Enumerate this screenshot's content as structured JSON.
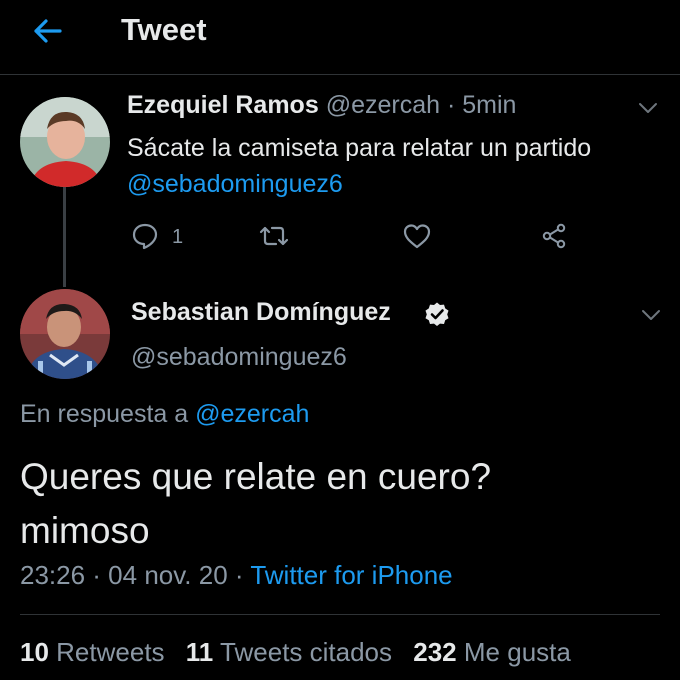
{
  "header": {
    "title": "Tweet"
  },
  "parent_tweet": {
    "name": "Ezequiel Ramos",
    "handle": "@ezercah",
    "time": "· 5min",
    "text": "Sácate la camiseta para relatar un partido",
    "mention": "@sebadominguez6",
    "reply_count": "1",
    "icons": {
      "reply": "reply-icon",
      "retweet": "retweet-icon",
      "like": "heart-icon",
      "share": "share-icon"
    }
  },
  "main_tweet": {
    "name": "Sebastian Domínguez",
    "handle": "@sebadominguez6",
    "reply_prefix": "En respuesta a",
    "reply_handle": "@ezercah",
    "text_line1": "Queres que relate en cuero?",
    "text_line2": "mimoso",
    "timestamp": "23:26 · 04 nov. 20 ·",
    "source": "Twitter for iPhone"
  },
  "stats": {
    "retweets_count": "10",
    "retweets_label": "Retweets",
    "quotes_count": "11",
    "quotes_label": "Tweets citados",
    "likes_count": "232",
    "likes_label": "Me gusta"
  },
  "colors": {
    "accent": "#1d9bf0",
    "muted": "#8b98a5",
    "background": "#000000"
  }
}
